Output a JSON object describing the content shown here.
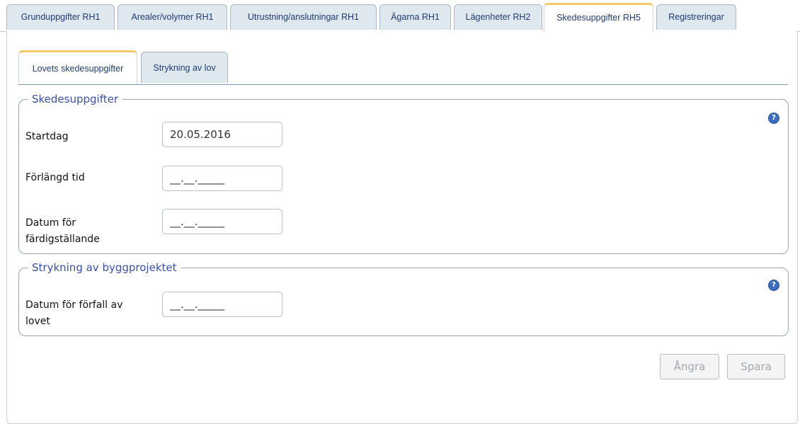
{
  "top_tabs": [
    {
      "label": "Grunduppgifter RH1"
    },
    {
      "label": "Arealer/volymer RH1"
    },
    {
      "label": "Utrustning/anslutningar RH1"
    },
    {
      "label": "Ägarna RH1"
    },
    {
      "label": "Lägenheter RH2"
    },
    {
      "label": "Skedesuppgifter RH5",
      "active": true
    },
    {
      "label": "Registreringar"
    }
  ],
  "sub_tabs": [
    {
      "label": "Lovets skedesuppgifter",
      "active": true
    },
    {
      "label": "Strykning av lov"
    }
  ],
  "group_stage": {
    "legend": "Skedesuppgifter",
    "help_icon": "?",
    "fields": {
      "startdag": {
        "label": "Startdag",
        "value": "20.05.2016"
      },
      "forlangd": {
        "label": "Förlängd tid",
        "value": "__.__._____"
      },
      "fardig": {
        "label1": "Datum för",
        "label2": "färdigställande",
        "value": "__.__._____"
      }
    }
  },
  "group_cancel": {
    "legend": "Strykning av byggprojektet",
    "help_icon": "?",
    "fields": {
      "forfall": {
        "label1": "Datum för förfall av",
        "label2": "lovet",
        "value": "__.__._____"
      }
    }
  },
  "buttons": {
    "undo": "Ångra",
    "save": "Spara"
  },
  "colors": {
    "accent_tab": "#f4c96b",
    "legend": "#3a4fa8",
    "tab_text": "#1f3b73",
    "help": "#3d6dbf"
  }
}
